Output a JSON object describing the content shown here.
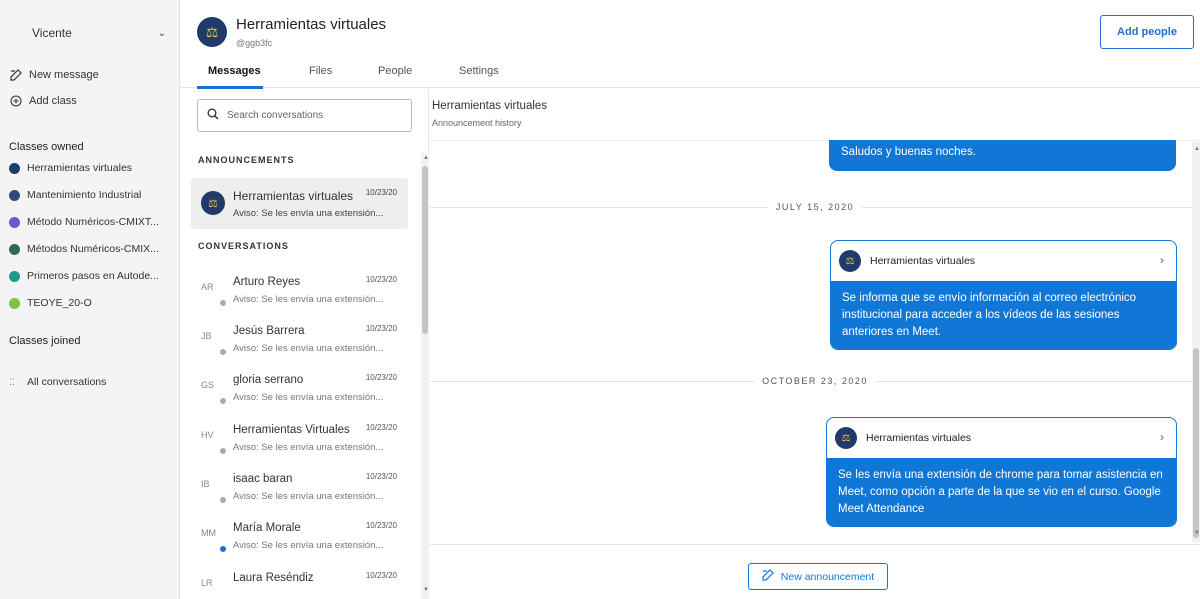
{
  "sidebar": {
    "user": "Vicente",
    "new_message": "New message",
    "add_class": "Add class",
    "classes_owned_label": "Classes owned",
    "classes_owned": [
      {
        "label": "Herramientas virtuales",
        "color": "#1f3a6b"
      },
      {
        "label": "Mantenimiento Industrial",
        "color": "#2d4a7a"
      },
      {
        "label": "Método Numéricos-CMIXT...",
        "color": "#6a5acd"
      },
      {
        "label": "Métodos Numéricos-CMIX...",
        "color": "#2e6b4f"
      },
      {
        "label": "Primeros pasos en Autode...",
        "color": "#1a9c8a"
      },
      {
        "label": "TEOYE_20-O",
        "color": "#7dc243"
      }
    ],
    "classes_joined_label": "Classes joined",
    "all_conversations": "All conversations"
  },
  "header": {
    "class_name": "Herramientas virtuales",
    "class_code": "@ggb3fc",
    "add_people": "Add people",
    "tabs": [
      "Messages",
      "Files",
      "People",
      "Settings"
    ],
    "active_tab": "Messages"
  },
  "conversations": {
    "search_placeholder": "Search conversations",
    "announcements_label": "ANNOUNCEMENTS",
    "announcement": {
      "name": "Herramientas virtuales",
      "date": "10/23/20",
      "preview": "Aviso: Se les envía una extensión..."
    },
    "conversations_label": "CONVERSATIONS",
    "items": [
      {
        "initials": "AR",
        "name": "Arturo Reyes",
        "date": "10/23/20",
        "preview": "Aviso: Se les envía una extensión...",
        "badge": "gray"
      },
      {
        "initials": "JB",
        "name": "Jesús Barrera",
        "date": "10/23/20",
        "preview": "Aviso: Se les envía una extensión...",
        "badge": "gray"
      },
      {
        "initials": "GS",
        "name": "gloria serrano",
        "date": "10/23/20",
        "preview": "Aviso: Se les envía una extensión...",
        "badge": "gray"
      },
      {
        "initials": "HV",
        "name": "Herramientas Virtuales",
        "date": "10/23/20",
        "preview": "Aviso: Se les envía una extensión...",
        "badge": "gray"
      },
      {
        "initials": "IB",
        "name": "isaac baran",
        "date": "10/23/20",
        "preview": "Aviso: Se les envía una extensión...",
        "badge": "gray"
      },
      {
        "initials": "MM",
        "name": "María Morale",
        "date": "10/23/20",
        "preview": "Aviso: Se les envía una extensión...",
        "badge": "blue"
      },
      {
        "initials": "LR",
        "name": "Laura Reséndiz",
        "date": "10/23/20",
        "preview": "",
        "badge": "none"
      }
    ]
  },
  "main": {
    "title": "Herramientas virtuales",
    "subtitle": "Announcement history",
    "top_message": "Saludos y buenas noches.",
    "date_1": "JULY 15, 2020",
    "card_1": {
      "author": "Herramientas virtuales",
      "body": "Se informa que se envío información al correo electrónico institucional para acceder a los vídeos de las sesiones anteriores en Meet."
    },
    "date_2": "OCTOBER 23, 2020",
    "card_2": {
      "author": "Herramientas virtuales",
      "body": "Se les envía una extensión de chrome para tomar asistencia en Meet, como opción a parte de la que se vio en el curso. Google Meet Attendance"
    },
    "new_announcement": "New announcement"
  },
  "colors": {
    "accent": "#1177d6",
    "class_avatar": "#1f3a6b"
  },
  "icons": {
    "search": "search-icon",
    "compose": "compose-icon",
    "add": "add-circle-icon",
    "chevron": "chevron-right-icon"
  }
}
